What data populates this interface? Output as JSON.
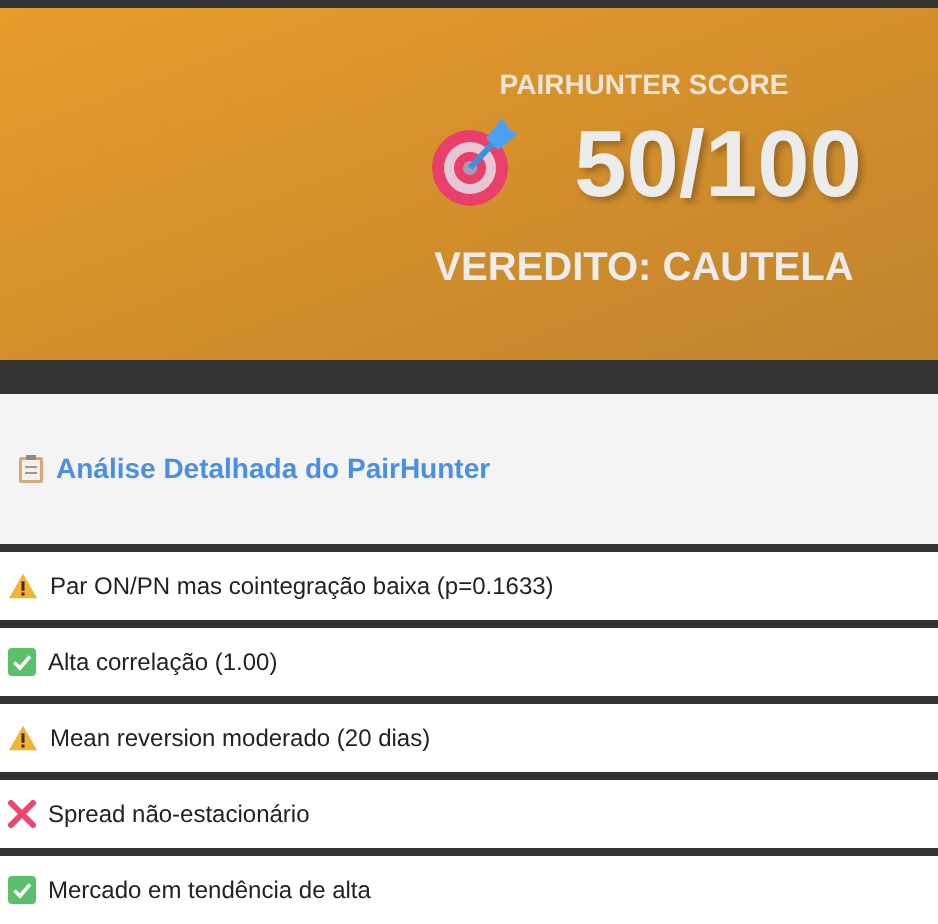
{
  "score_card": {
    "label": "PAIRHUNTER SCORE",
    "score": "50/100",
    "verdict": "VEREDITO: CAUTELA"
  },
  "analysis": {
    "title": "Análise Detalhada do PairHunter",
    "items": [
      {
        "kind": "warning",
        "text": "Par ON/PN mas cointegração baixa (p=0.1633)"
      },
      {
        "kind": "success",
        "text": "Alta correlação (1.00)"
      },
      {
        "kind": "warning",
        "text": "Mean reversion moderado (20 dias)"
      },
      {
        "kind": "error",
        "text": "Spread não-estacionário"
      },
      {
        "kind": "success",
        "text": "Mercado em tendência de alta"
      }
    ]
  }
}
